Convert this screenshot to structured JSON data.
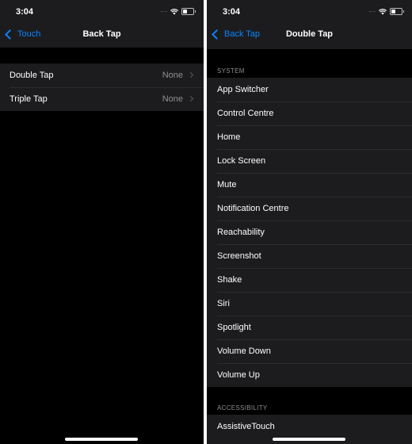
{
  "left": {
    "status": {
      "time": "3:04"
    },
    "nav": {
      "back_label": "Touch",
      "title": "Back Tap"
    },
    "rows": [
      {
        "label": "Double Tap",
        "value": "None"
      },
      {
        "label": "Triple Tap",
        "value": "None"
      }
    ]
  },
  "right": {
    "status": {
      "time": "3:04"
    },
    "nav": {
      "back_label": "Back Tap",
      "title": "Double Tap"
    },
    "sections": [
      {
        "header": "SYSTEM",
        "items": [
          "App Switcher",
          "Control Centre",
          "Home",
          "Lock Screen",
          "Mute",
          "Notification Centre",
          "Reachability",
          "Screenshot",
          "Shake",
          "Siri",
          "Spotlight",
          "Volume Down",
          "Volume Up"
        ]
      },
      {
        "header": "ACCESSIBILITY",
        "items": [
          "AssistiveTouch"
        ]
      }
    ]
  },
  "colors": {
    "accent": "#0a84ff",
    "background": "#000000",
    "cell": "#1c1c1e",
    "secondary_text": "#8e8e93"
  }
}
